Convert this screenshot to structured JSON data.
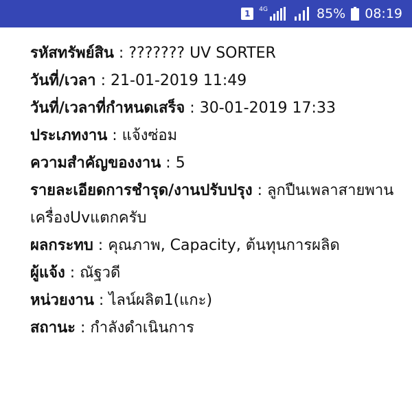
{
  "status_bar": {
    "sim_label": "1",
    "network_label": "4G",
    "battery_percent": "85%",
    "time": "08:19"
  },
  "fields": [
    {
      "label": "รหัสทรัพย์สิน",
      "value": "??????? UV SORTER"
    },
    {
      "label": "วันที่/เวลา",
      "value": "21-01-2019 11:49"
    },
    {
      "label": "วันที่/เวลาที่กำหนดเสร็จ",
      "value": "30-01-2019 17:33"
    },
    {
      "label": "ประเภทงาน",
      "value": "แจ้งซ่อม"
    },
    {
      "label": "ความสำคัญของงาน",
      "value": "5"
    },
    {
      "label": "รายละเอียดการชำรุด/งานปรับปรุง",
      "value": "ลูกปืนเพลาสายพานเครื่องUvแตกครับ"
    },
    {
      "label": "ผลกระทบ",
      "value": "คุณภาพ, Capacity, ต้นทุนการผลิด"
    },
    {
      "label": "ผู้แจ้ง",
      "value": "ณัฐวดี"
    },
    {
      "label": "หน่วยงาน",
      "value": "ไลน์ผลิต1(แกะ)"
    },
    {
      "label": "สถานะ",
      "value": "กำลังดำเนินการ"
    }
  ],
  "separator": " : ",
  "colors": {
    "status_bar_bg": "#3546b5",
    "text": "#111111"
  }
}
